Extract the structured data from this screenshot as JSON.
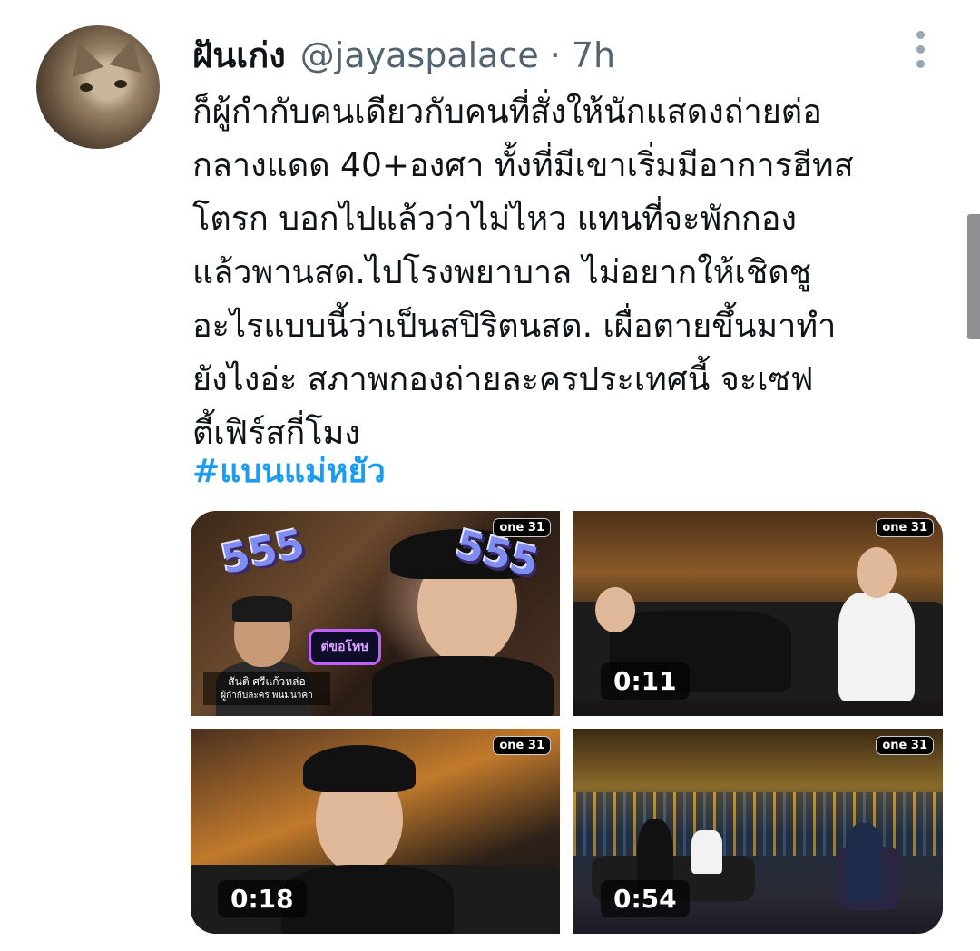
{
  "tweet": {
    "display_name": "ฝันเก่ง",
    "handle": "@jayaspalace",
    "separator": "·",
    "time": "7h",
    "text_lines": [
      "ก็ผู้กำกับคนเดียวกับคนที่สั่งให้นักแสดงถ่ายต่อ",
      "กลางแดด 40+องศา ทั้งที่มีเขาเริ่มมีอาการฮีทส",
      "โตรก บอกไปแล้วว่าไม่ไหว แทนที่จะพักกอง",
      "แล้วพานสด.ไปโรงพยาบาล ไม่อยากให้เชิดชู",
      "อะไรแบบนี้ว่าเป็นสปิริตนสด. เผื่อตายขึ้นมาทำ",
      "ยังไงอ่ะ สภาพกองถ่ายละครประเทศนี้ จะเซฟ",
      "ตี้เฟิร์สกี่โมง"
    ],
    "hashtag": "#แบนแม่หยัว"
  },
  "media": {
    "channel_logo": "one 31",
    "tiles": [
      {
        "overlay_555_a": "555",
        "overlay_555_b": "555",
        "bubble_text": "ต่ขอโทษ",
        "caption_line1": "สันติ ศรีแก้วหล่อ",
        "caption_line2": "ผู้กำกับละคร พนมนาคา"
      },
      {
        "duration": "0:11"
      },
      {
        "duration": "0:18"
      },
      {
        "duration": "0:54"
      }
    ]
  },
  "icons": {
    "more": "more-vertical-icon"
  },
  "colors": {
    "text": "#0f1419",
    "secondary": "#536471",
    "link": "#1d9bf0"
  }
}
